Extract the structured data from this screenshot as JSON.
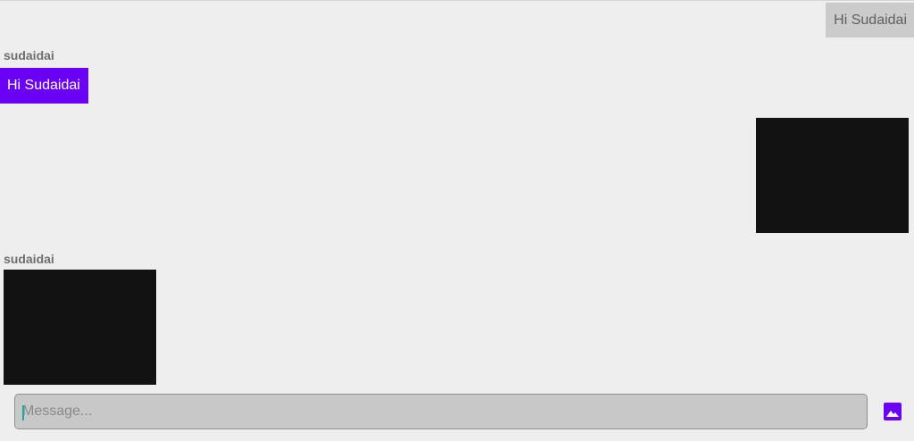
{
  "messages": {
    "outgoing_text": "Hi Sudaidai",
    "incoming_sender_1": "sudaidai",
    "incoming_text": "Hi Sudaidai",
    "incoming_sender_2": "sudaidai"
  },
  "composer": {
    "placeholder": "Message...",
    "attach_icon": "image-icon"
  },
  "colors": {
    "background": "#eeeeee",
    "incoming_bubble": "#6a00f4",
    "outgoing_bubble": "#cbcbcb",
    "accent": "#6a00f4",
    "image_placeholder": "#121212"
  }
}
